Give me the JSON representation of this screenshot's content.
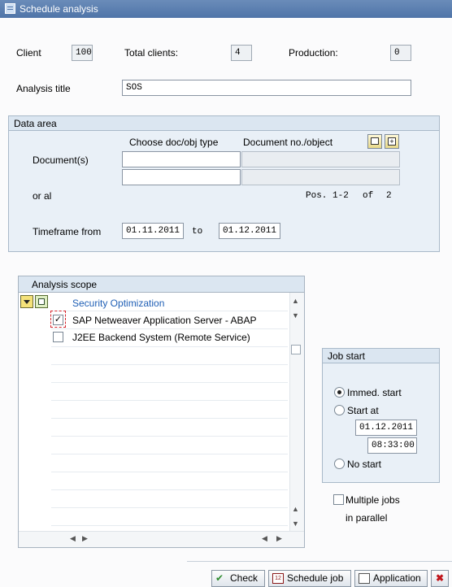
{
  "window": {
    "title": "Schedule analysis"
  },
  "header": {
    "client_label": "Client",
    "client_value": "100",
    "total_clients_label": "Total clients:",
    "total_clients_value": "4",
    "production_label": "Production:",
    "production_value": "0",
    "analysis_title_label": "Analysis title",
    "analysis_title_value": "SOS"
  },
  "data_area": {
    "title": "Data area",
    "col1": "Choose doc/obj type",
    "col2": "Document no./object",
    "documents_label": "Document(s)",
    "or_al_label": "or al",
    "pos_text": "Pos. 1-2",
    "of_text": "of",
    "total_text": "2",
    "timeframe_label": "Timeframe from",
    "from_value": "01.11.2011",
    "to_label": "to",
    "to_value": "01.12.2011"
  },
  "scope": {
    "title": "Analysis scope",
    "root": "Security Optimization",
    "items": [
      {
        "label": "SAP Netweaver Application Server - ABAP",
        "checked": true
      },
      {
        "label": "J2EE Backend System (Remote Service)",
        "checked": false
      }
    ]
  },
  "job_start": {
    "title": "Job start",
    "immed_label": "Immed. start",
    "start_at_label": "Start at",
    "date_value": "01.12.2011",
    "time_value": "08:33:00",
    "no_start_label": "No start",
    "selected": "immed"
  },
  "multiple_jobs": {
    "line1": "Multiple jobs",
    "line2": "in parallel",
    "checked": false
  },
  "buttons": {
    "check": "Check",
    "schedule": "Schedule job",
    "application": "Application"
  },
  "colors": {
    "link_blue": "#1f5fb5",
    "title_bar": "#4f74a8",
    "cancel_red": "#c0161c"
  }
}
